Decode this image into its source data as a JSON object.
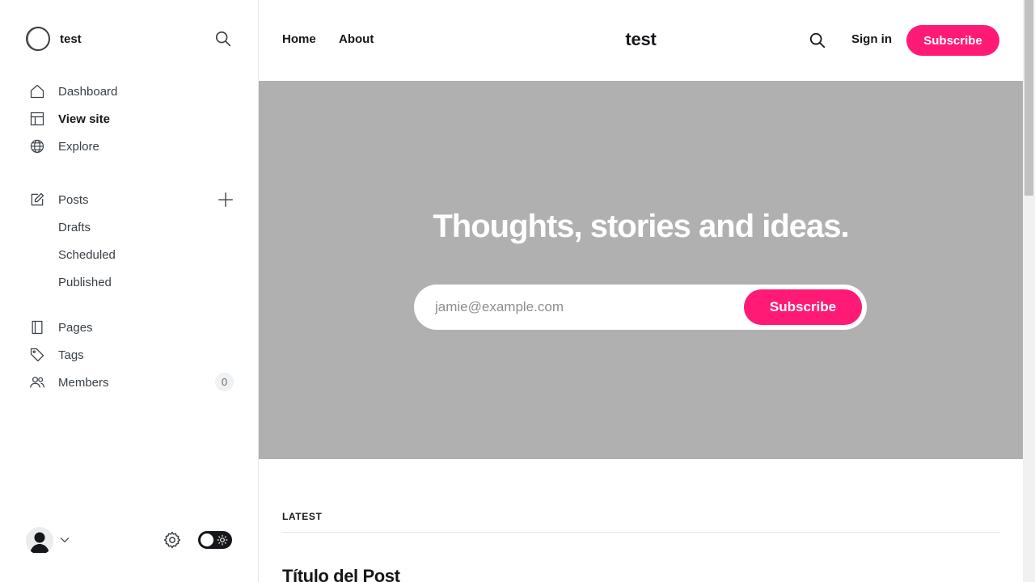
{
  "sidebar": {
    "site_name": "test",
    "nav": {
      "dashboard": "Dashboard",
      "view_site": "View site",
      "explore": "Explore",
      "posts": "Posts",
      "drafts": "Drafts",
      "scheduled": "Scheduled",
      "published": "Published",
      "pages": "Pages",
      "tags": "Tags",
      "members": "Members",
      "members_count": "0"
    },
    "active_item": "View site",
    "dark_mode_toggle": "on"
  },
  "site": {
    "nav_links": [
      "Home",
      "About"
    ],
    "title": "test",
    "sign_in": "Sign in",
    "subscribe": "Subscribe",
    "hero": {
      "heading": "Thoughts, stories and ideas.",
      "email_placeholder": "jamie@example.com",
      "button": "Subscribe",
      "background_color": "#b0b0b0"
    },
    "feed": {
      "section_label": "LATEST",
      "first_post_title": "Título del Post"
    },
    "accent_color": "#ff1a75"
  }
}
